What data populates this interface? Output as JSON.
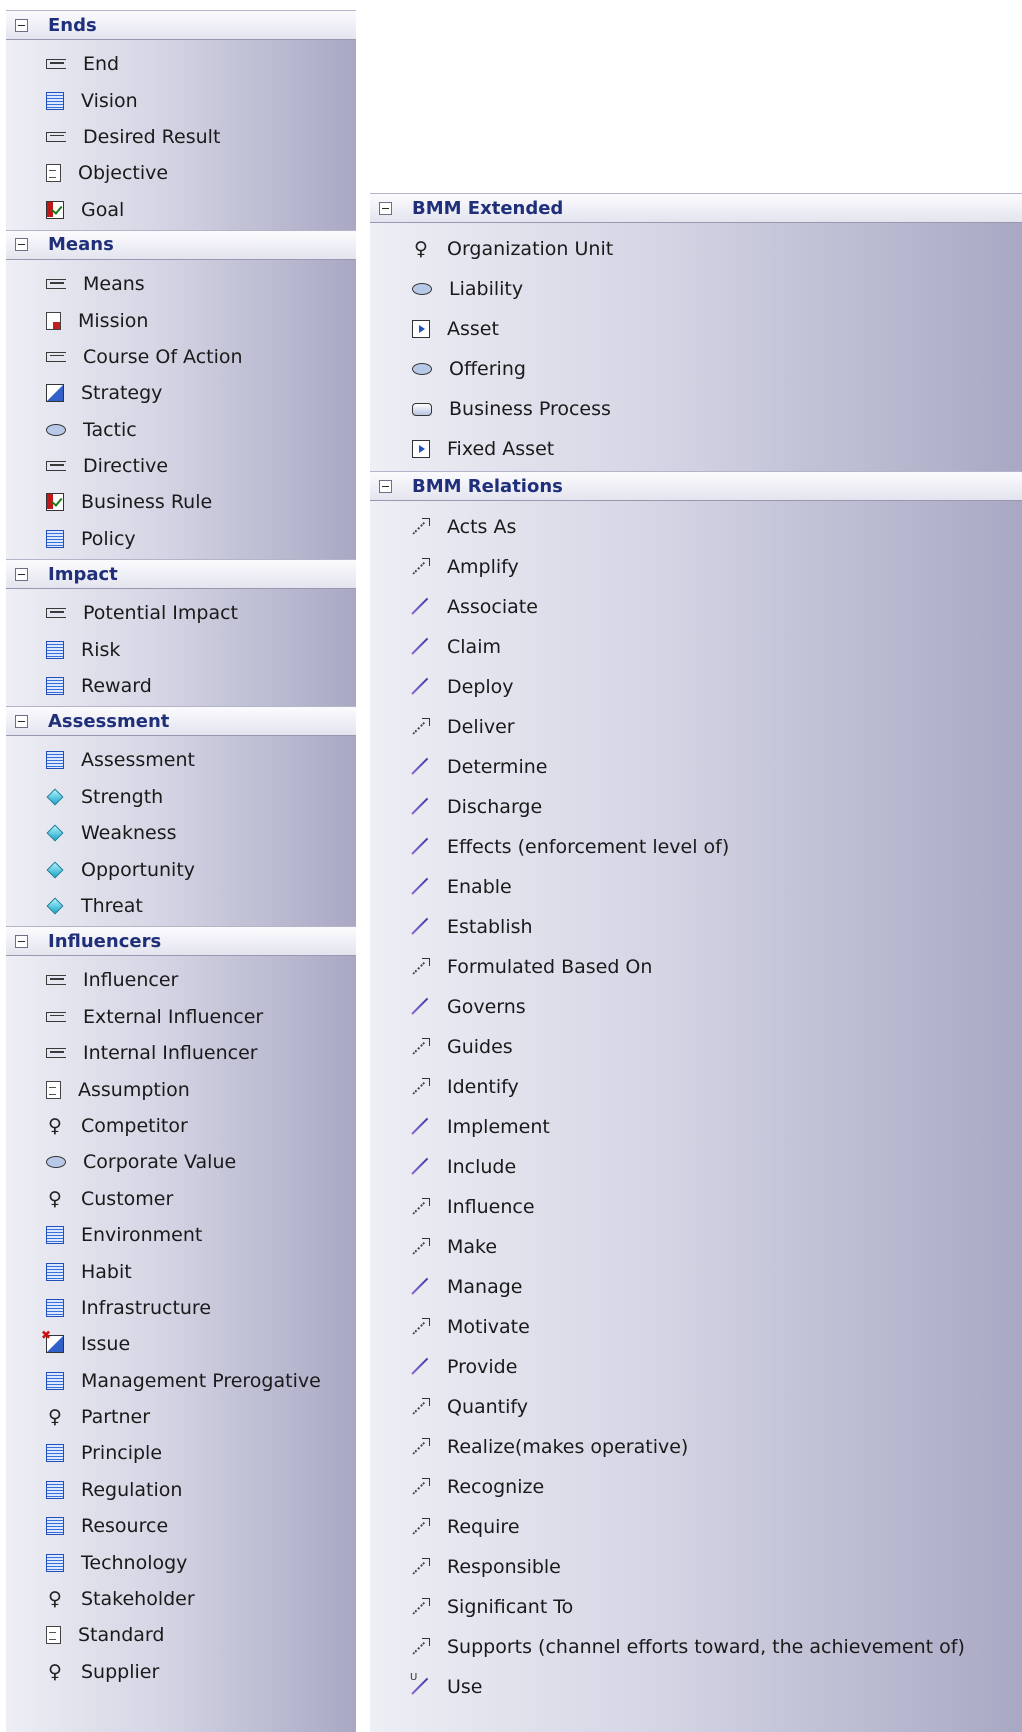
{
  "left_sections": [
    {
      "title": "Ends",
      "items": [
        {
          "label": "End",
          "icon": "bracket-icon"
        },
        {
          "label": "Vision",
          "icon": "document-blue-icon"
        },
        {
          "label": "Desired Result",
          "icon": "bracket-icon"
        },
        {
          "label": "Objective",
          "icon": "page-icon"
        },
        {
          "label": "Goal",
          "icon": "checkbox-icon"
        }
      ]
    },
    {
      "title": "Means",
      "items": [
        {
          "label": "Means",
          "icon": "bracket-icon"
        },
        {
          "label": "Mission",
          "icon": "page-red-icon"
        },
        {
          "label": "Course Of Action",
          "icon": "bracket-icon"
        },
        {
          "label": "Strategy",
          "icon": "strategy-icon"
        },
        {
          "label": "Tactic",
          "icon": "ellipse-icon"
        },
        {
          "label": "Directive",
          "icon": "bracket-icon"
        },
        {
          "label": "Business Rule",
          "icon": "checkbox-icon"
        },
        {
          "label": "Policy",
          "icon": "document-blue-icon"
        }
      ]
    },
    {
      "title": "Impact",
      "items": [
        {
          "label": "Potential Impact",
          "icon": "bracket-icon"
        },
        {
          "label": "Risk",
          "icon": "document-blue-icon"
        },
        {
          "label": "Reward",
          "icon": "document-blue-icon"
        }
      ]
    },
    {
      "title": "Assessment",
      "items": [
        {
          "label": "Assessment",
          "icon": "document-blue-icon"
        },
        {
          "label": "Strength",
          "icon": "diamond-icon"
        },
        {
          "label": "Weakness",
          "icon": "diamond-icon"
        },
        {
          "label": "Opportunity",
          "icon": "diamond-icon"
        },
        {
          "label": "Threat",
          "icon": "diamond-icon"
        }
      ]
    },
    {
      "title": "Influencers",
      "items": [
        {
          "label": "Influencer",
          "icon": "bracket-icon"
        },
        {
          "label": "External Influencer",
          "icon": "bracket-icon"
        },
        {
          "label": "Internal Influencer",
          "icon": "bracket-icon"
        },
        {
          "label": "Assumption",
          "icon": "page-icon"
        },
        {
          "label": "Competitor",
          "icon": "actor-icon"
        },
        {
          "label": "Corporate Value",
          "icon": "ellipse-icon"
        },
        {
          "label": "Customer",
          "icon": "actor-icon"
        },
        {
          "label": "Environment",
          "icon": "document-blue-icon"
        },
        {
          "label": "Habit",
          "icon": "document-blue-icon"
        },
        {
          "label": "Infrastructure",
          "icon": "document-blue-icon"
        },
        {
          "label": "Issue",
          "icon": "issue-icon"
        },
        {
          "label": "Management Prerogative",
          "icon": "document-blue-icon"
        },
        {
          "label": "Partner",
          "icon": "actor-icon"
        },
        {
          "label": "Principle",
          "icon": "document-blue-icon"
        },
        {
          "label": "Regulation",
          "icon": "document-blue-icon"
        },
        {
          "label": "Resource",
          "icon": "document-blue-icon"
        },
        {
          "label": "Technology",
          "icon": "document-blue-icon"
        },
        {
          "label": "Stakeholder",
          "icon": "actor-icon"
        },
        {
          "label": "Standard",
          "icon": "page-icon"
        },
        {
          "label": "Supplier",
          "icon": "actor-icon"
        }
      ]
    }
  ],
  "right_sections": [
    {
      "title": "BMM Extended",
      "items": [
        {
          "label": "Organization Unit",
          "icon": "actor-icon"
        },
        {
          "label": "Liability",
          "icon": "ellipse-icon"
        },
        {
          "label": "Asset",
          "icon": "asset-icon"
        },
        {
          "label": "Offering",
          "icon": "ellipse-icon"
        },
        {
          "label": "Business Process",
          "icon": "process-icon"
        },
        {
          "label": "Fixed Asset",
          "icon": "asset-icon"
        }
      ]
    },
    {
      "title": "BMM Relations",
      "items": [
        {
          "label": "Acts As",
          "icon": "dotted-arrow-icon"
        },
        {
          "label": "Amplify",
          "icon": "dotted-arrow-icon"
        },
        {
          "label": "Associate",
          "icon": "line-icon"
        },
        {
          "label": "Claim",
          "icon": "line-icon"
        },
        {
          "label": "Deploy",
          "icon": "line-icon"
        },
        {
          "label": "Deliver",
          "icon": "dotted-arrow-icon"
        },
        {
          "label": "Determine",
          "icon": "line-icon"
        },
        {
          "label": "Discharge",
          "icon": "line-icon"
        },
        {
          "label": "Effects (enforcement level of)",
          "icon": "line-icon"
        },
        {
          "label": "Enable",
          "icon": "line-icon"
        },
        {
          "label": "Establish",
          "icon": "line-icon"
        },
        {
          "label": "Formulated Based On",
          "icon": "dotted-arrow-icon"
        },
        {
          "label": "Governs",
          "icon": "line-icon"
        },
        {
          "label": "Guides",
          "icon": "dotted-arrow-icon"
        },
        {
          "label": "Identify",
          "icon": "dotted-arrow-icon"
        },
        {
          "label": "Implement",
          "icon": "line-icon"
        },
        {
          "label": "Include",
          "icon": "line-icon"
        },
        {
          "label": "Influence",
          "icon": "dotted-arrow-icon"
        },
        {
          "label": "Make",
          "icon": "dotted-arrow-icon"
        },
        {
          "label": "Manage",
          "icon": "line-icon"
        },
        {
          "label": "Motivate",
          "icon": "dotted-arrow-icon"
        },
        {
          "label": "Provide",
          "icon": "line-icon"
        },
        {
          "label": "Quantify",
          "icon": "dotted-arrow-icon"
        },
        {
          "label": "Realize(makes operative)",
          "icon": "dotted-arrow-icon"
        },
        {
          "label": "Recognize",
          "icon": "dotted-arrow-icon"
        },
        {
          "label": "Require",
          "icon": "dotted-arrow-icon"
        },
        {
          "label": "Responsible",
          "icon": "dotted-arrow-icon"
        },
        {
          "label": "Significant To",
          "icon": "dotted-arrow-icon"
        },
        {
          "label": "Supports (channel efforts toward, the achievement of)",
          "icon": "dotted-arrow-icon"
        },
        {
          "label": "Use",
          "icon": "use-icon"
        }
      ]
    }
  ]
}
